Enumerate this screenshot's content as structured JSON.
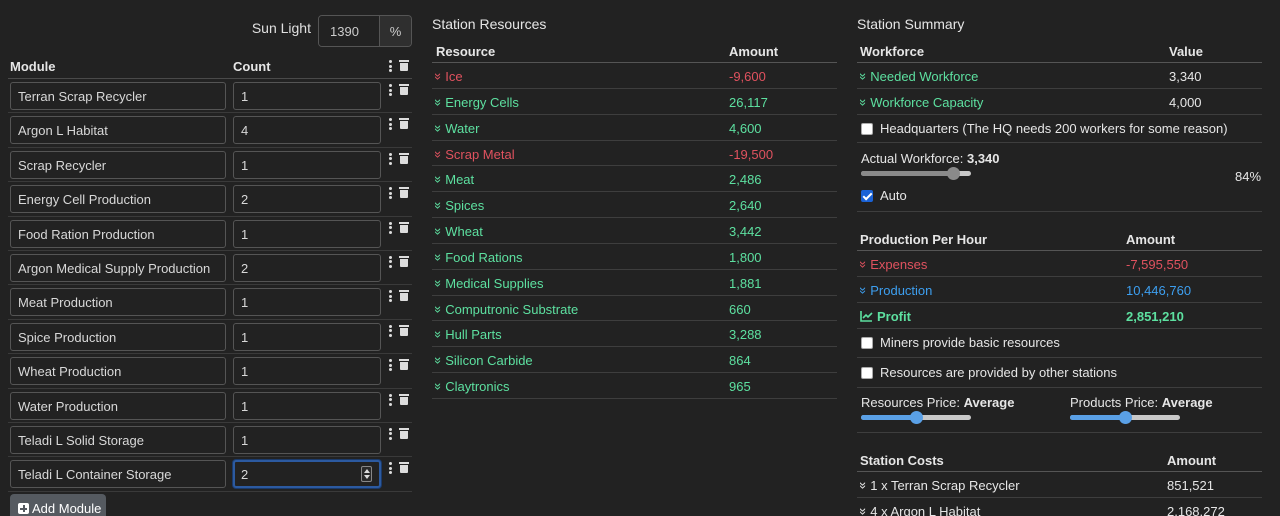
{
  "sunlight": {
    "label": "Sun Light",
    "value": "1390",
    "unit": "%"
  },
  "modules": {
    "header": {
      "module": "Module",
      "count": "Count"
    },
    "rows": [
      {
        "name": "Terran Scrap Recycler",
        "count": "1"
      },
      {
        "name": "Argon L Habitat",
        "count": "4"
      },
      {
        "name": "Scrap Recycler",
        "count": "1"
      },
      {
        "name": "Energy Cell Production",
        "count": "2"
      },
      {
        "name": "Food Ration Production",
        "count": "1"
      },
      {
        "name": "Argon Medical Supply Production",
        "count": "2"
      },
      {
        "name": "Meat Production",
        "count": "1"
      },
      {
        "name": "Spice Production",
        "count": "1"
      },
      {
        "name": "Wheat Production",
        "count": "1"
      },
      {
        "name": "Water Production",
        "count": "1"
      },
      {
        "name": "Teladi L Solid Storage",
        "count": "1"
      },
      {
        "name": "Teladi L Container Storage",
        "count": "2"
      }
    ],
    "add_label": "Add Module"
  },
  "resources": {
    "title": "Station Resources",
    "header": {
      "resource": "Resource",
      "amount": "Amount"
    },
    "rows": [
      {
        "name": "Ice",
        "amount": "-9,600",
        "status": "negative"
      },
      {
        "name": "Energy Cells",
        "amount": "26,117",
        "status": "positive"
      },
      {
        "name": "Water",
        "amount": "4,600",
        "status": "positive"
      },
      {
        "name": "Scrap Metal",
        "amount": "-19,500",
        "status": "negative"
      },
      {
        "name": "Meat",
        "amount": "2,486",
        "status": "positive"
      },
      {
        "name": "Spices",
        "amount": "2,640",
        "status": "positive"
      },
      {
        "name": "Wheat",
        "amount": "3,442",
        "status": "positive"
      },
      {
        "name": "Food Rations",
        "amount": "1,800",
        "status": "positive"
      },
      {
        "name": "Medical Supplies",
        "amount": "1,881",
        "status": "positive"
      },
      {
        "name": "Computronic Substrate",
        "amount": "660",
        "status": "positive"
      },
      {
        "name": "Hull Parts",
        "amount": "3,288",
        "status": "positive"
      },
      {
        "name": "Silicon Carbide",
        "amount": "864",
        "status": "positive"
      },
      {
        "name": "Claytronics",
        "amount": "965",
        "status": "positive"
      }
    ]
  },
  "summary": {
    "title": "Station Summary",
    "workforce": {
      "header": {
        "name": "Workforce",
        "value": "Value"
      },
      "needed": {
        "label": "Needed Workforce",
        "value": "3,340"
      },
      "capacity": {
        "label": "Workforce Capacity",
        "value": "4,000"
      },
      "hq_label": "Headquarters (The HQ needs 200 workers for some reason)",
      "actual_label": "Actual Workforce:",
      "actual_value": "3,340",
      "percent": "84%",
      "slider_fraction": 0.84,
      "auto_label": "Auto"
    },
    "production": {
      "header": {
        "name": "Production Per Hour",
        "value": "Amount"
      },
      "expenses": {
        "label": "Expenses",
        "value": "-7,595,550"
      },
      "production": {
        "label": "Production",
        "value": "10,446,760"
      },
      "profit": {
        "label": "Profit",
        "value": "2,851,210"
      },
      "miners_label": "Miners provide basic resources",
      "provided_label": "Resources are provided by other stations",
      "resources_price_label": "Resources Price:",
      "resources_price_value": "Average",
      "resources_price_fraction": 0.5,
      "products_price_label": "Products Price:",
      "products_price_value": "Average",
      "products_price_fraction": 0.5
    },
    "costs": {
      "header": {
        "name": "Station Costs",
        "value": "Amount"
      },
      "rows": [
        {
          "label": "1 x Terran Scrap Recycler",
          "value": "851,521"
        },
        {
          "label": "4 x Argon L Habitat",
          "value": "2,168,272"
        }
      ]
    }
  },
  "colors": {
    "negative": "#e0525f",
    "positive": "#5de0a0",
    "production": "#3d9ff0",
    "slider_fill": "#5aa0e6",
    "workforce_slider_fill": "#8a8a8a",
    "focus_border": "#2c5aa0"
  },
  "icons": {
    "kebab": "kebab-menu-icon",
    "trash": "trash-icon",
    "chevron": "chevron-double-down-icon",
    "plus": "plus-square-icon",
    "profit": "chart-line-icon",
    "checkbox": "checkbox-icon"
  }
}
